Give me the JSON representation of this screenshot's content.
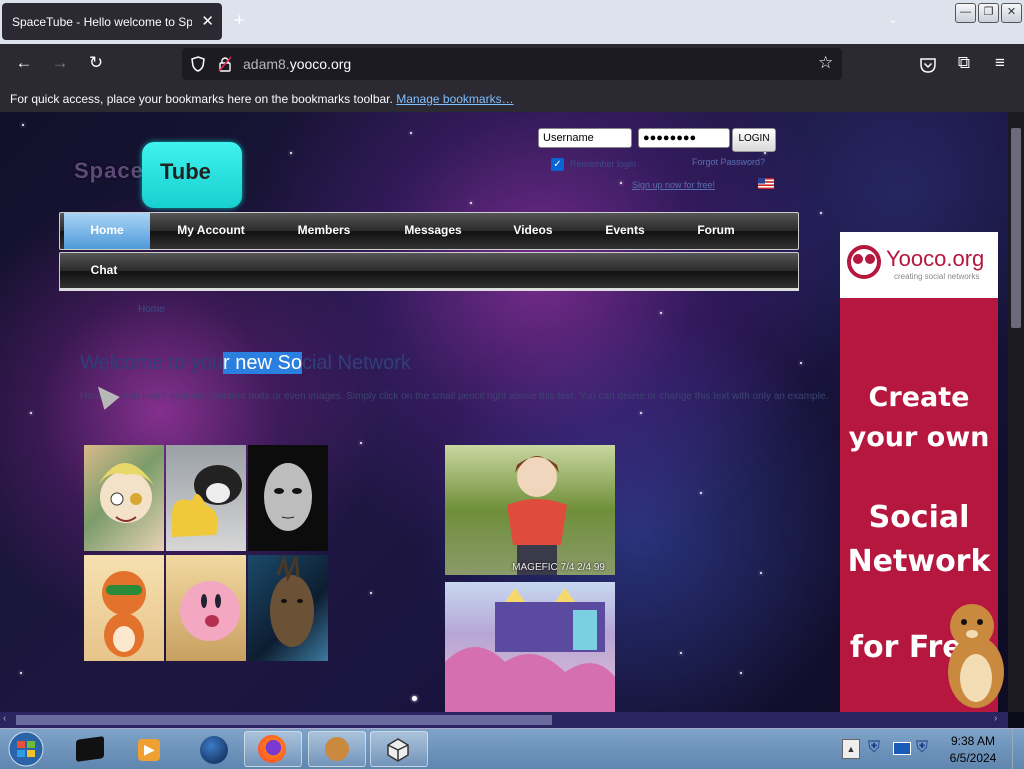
{
  "browser": {
    "tab_title": "SpaceTube - Hello welcome to SpaceTube",
    "tab_close": "✕",
    "new_tab": "+",
    "url_prefix": "adam8.",
    "url_domain": "yooco.org",
    "bookmarks_message": "For quick access, place your bookmarks here on the bookmarks toolbar.",
    "manage_bookmarks": "Manage bookmarks…"
  },
  "login": {
    "username_value": "Username",
    "password_value": "●●●●●●●●",
    "login_label": "LOGIN",
    "remember_label": "Remember login",
    "forgot_label": "Forgot Password?",
    "signup_label": "Sign up now for free!"
  },
  "logo": {
    "part1": "Space",
    "part2": "Tube"
  },
  "menu": {
    "row1": [
      "Home",
      "My Account",
      "Members",
      "Messages",
      "Videos",
      "Events",
      "Forum"
    ],
    "row2": [
      "Chat"
    ]
  },
  "faint_link": "Home",
  "welcome": {
    "before": "Welcome to you",
    "highlight": "r new So",
    "after": "cial Network"
  },
  "intro_text": "Here you can insert your own content texts or even images. Simply click on the small pencil right above this text. You can delete or change this text with only an example.",
  "photo_watermark": "MAGEFIC 7/4 2/4 99",
  "ad": {
    "brand": "Yooco.org",
    "tagline": "creating social networks",
    "line1": "Create",
    "line2": "your own",
    "line3": "Social",
    "line4": "Network",
    "line5": "for Free"
  },
  "taskbar": {
    "time": "9:38 AM",
    "date": "6/5/2024"
  }
}
